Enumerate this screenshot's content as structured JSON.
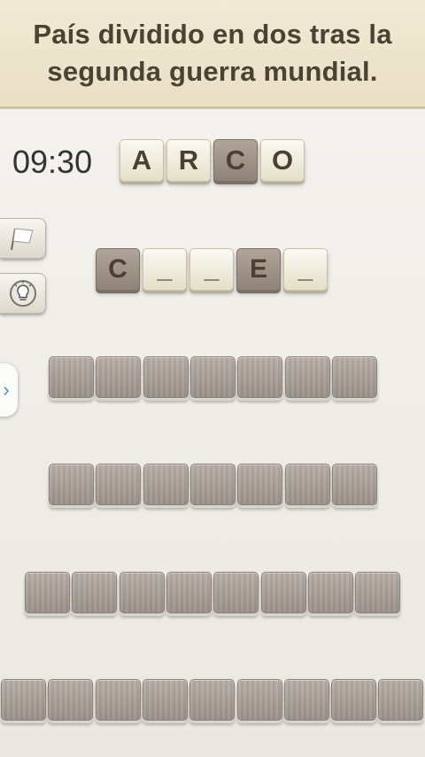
{
  "question": "País dividido en dos tras la segunda guerra mundial.",
  "timer": "09:30",
  "letter_bank": [
    {
      "letter": "A",
      "used": false
    },
    {
      "letter": "R",
      "used": false
    },
    {
      "letter": "C",
      "used": true
    },
    {
      "letter": "O",
      "used": false
    }
  ],
  "current_answer": [
    "C",
    "_",
    "_",
    "E",
    "_"
  ],
  "hidden_rows": [
    7,
    7,
    8,
    9
  ],
  "sidebar": {
    "flag_icon": "flag-icon",
    "hint_icon": "lightbulb-icon"
  },
  "drawer_icon": "chevron-right-icon"
}
